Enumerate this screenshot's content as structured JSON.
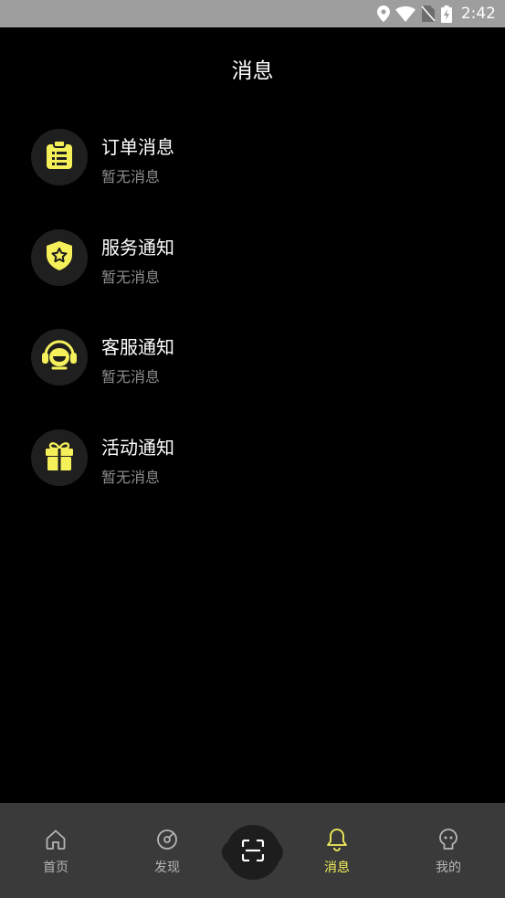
{
  "status_bar": {
    "time": "2:42",
    "icons": [
      "location-icon",
      "wifi-icon",
      "no-sim-icon",
      "battery-charging-icon"
    ]
  },
  "header": {
    "title": "消息"
  },
  "messages": [
    {
      "title": "订单消息",
      "subtitle": "暂无消息",
      "icon": "clipboard-icon"
    },
    {
      "title": "服务通知",
      "subtitle": "暂无消息",
      "icon": "shield-star-icon"
    },
    {
      "title": "客服通知",
      "subtitle": "暂无消息",
      "icon": "headset-icon"
    },
    {
      "title": "活动通知",
      "subtitle": "暂无消息",
      "icon": "gift-icon"
    }
  ],
  "bottom_nav": {
    "items": [
      {
        "label": "首页",
        "icon": "home-icon"
      },
      {
        "label": "发现",
        "icon": "compass-icon"
      },
      {
        "label": "消息",
        "icon": "bell-icon",
        "active": true
      },
      {
        "label": "我的",
        "icon": "profile-icon"
      }
    ],
    "center": {
      "icon": "scan-icon"
    }
  },
  "colors": {
    "accent": "#f5f05a",
    "background": "#000000",
    "nav_background": "#3a3a3a",
    "icon_circle": "#1f1f1f",
    "status_bar": "#9e9e9e"
  }
}
